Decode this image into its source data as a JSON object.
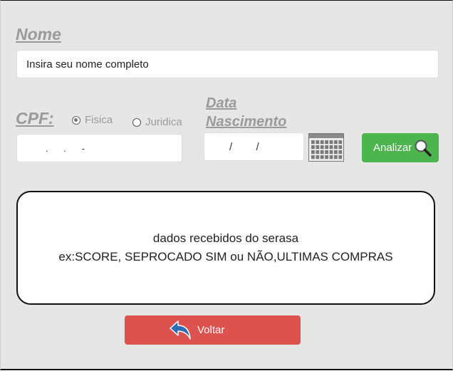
{
  "form": {
    "nome_label": "Nome",
    "nome_placeholder": "Insira seu nome completo",
    "cpf_label": "CPF:",
    "radio_fisica": "Fisica",
    "radio_juridica": "Juridica",
    "cpf_mask": ".      .      -",
    "data_label_line1": "Data",
    "data_label_line2": "Nascimento",
    "date_mask": "/        /",
    "analyze_label": "Analizar"
  },
  "result": {
    "line1": "dados recebidos do serasa",
    "line2": "ex:SCORE, SEPROCADO SIM ou NÃO,ULTIMAS COMPRAS"
  },
  "actions": {
    "back_label": "Voltar"
  },
  "colors": {
    "analyze_button": "#4cb54e",
    "back_button": "#dc524e",
    "label_gray": "#9a9a9a"
  },
  "icons": {
    "calendar": "calendar-icon",
    "search": "magnifier-icon",
    "back": "undo-arrow-icon"
  }
}
